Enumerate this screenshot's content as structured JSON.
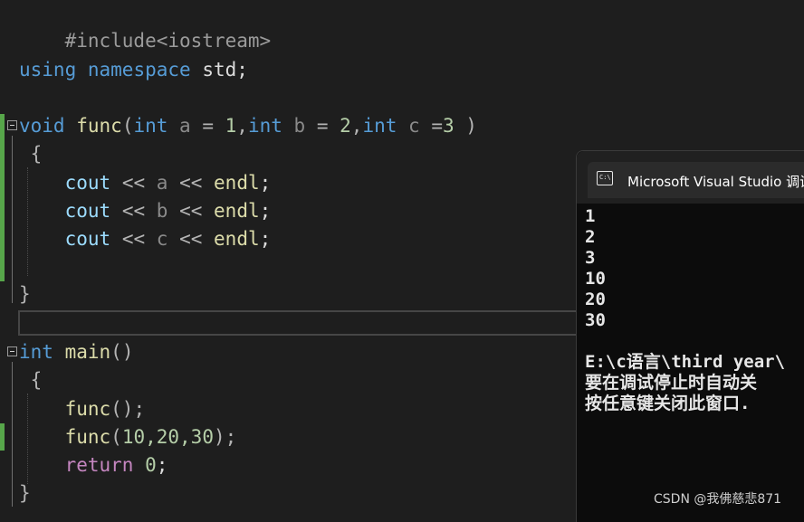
{
  "code_lines": {
    "l1_include": "#include<iostream>",
    "l2_using": "using",
    "l2_namespace": "namespace",
    "l2_std": "std",
    "l2_semicolon": ";",
    "l3_void": "void",
    "l3_func": "func",
    "l3_paren_open": "(",
    "l3_int1": "int",
    "l3_a": " a ",
    "l3_eq1": "=",
    "l3_one": " 1",
    "l3_comma1": ",",
    "l3_int2": "int",
    "l3_b": " b ",
    "l3_eq2": "=",
    "l3_two": " 2",
    "l3_comma2": ",",
    "l3_int3": "int",
    "l3_c": " c ",
    "l3_eq3": "=",
    "l3_three": "3",
    "l3_paren_close": " )",
    "brace_open": "{",
    "brace_close": "}",
    "cout": "cout",
    "shift": "<<",
    "var_a": "a",
    "var_b": "b",
    "var_c": "c",
    "endl": "endl",
    "semicolon": ";",
    "l_main_int": "int",
    "l_main_name": "main",
    "l_main_parens": "()",
    "call_func": "func",
    "call_empty_args": "();",
    "call_paren_open": "(",
    "call_args": "10,20,30",
    "call_paren_close": ");",
    "return_kw": "return",
    "return_val": " 0",
    "return_semicolon": ";"
  },
  "console": {
    "title": "Microsoft Visual Studio 调试",
    "icon": "console-icon",
    "icon_glyph": "C:\\",
    "output": [
      "1",
      "2",
      "3",
      "10",
      "20",
      "30"
    ],
    "path_line": "E:\\c语言\\third year\\",
    "msg_line1": "要在调试停止时自动关",
    "msg_line2": "按任意键关闭此窗口."
  },
  "watermark": "CSDN @我佛慈悲871",
  "colors": {
    "background": "#1e1e1e",
    "keyword": "#569cd6",
    "function": "#dcdcaa",
    "number": "#b5cea8",
    "change_bar": "#57a64a"
  }
}
